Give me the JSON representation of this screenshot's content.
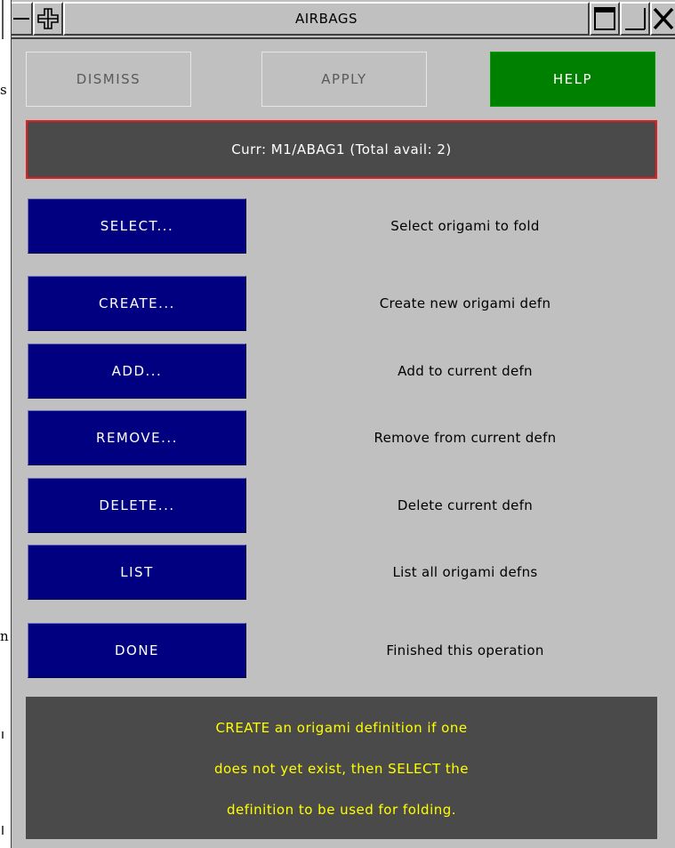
{
  "window": {
    "title": "AIRBAGS",
    "controls": {
      "menu_icon": "minus-icon",
      "move_icon": "move-cross-icon",
      "maximize_icon": "maximize-icon",
      "minimize_icon": "minimize-icon",
      "close_icon": "close-icon"
    }
  },
  "toolbar": {
    "dismiss_label": "DISMISS",
    "apply_label": "APPLY",
    "help_label": "HELP"
  },
  "current": {
    "text": "Curr: M1/ABAG1 (Total avail: 2)"
  },
  "actions": [
    {
      "label": "SELECT...",
      "description": "Select origami to fold"
    },
    {
      "label": "CREATE...",
      "description": "Create new origami defn"
    },
    {
      "label": "ADD...",
      "description": "Add to current defn"
    },
    {
      "label": "REMOVE...",
      "description": "Remove from current defn"
    },
    {
      "label": "DELETE...",
      "description": "Delete current defn"
    },
    {
      "label": "LIST",
      "description": "List all origami defns"
    },
    {
      "label": "DONE",
      "description": "Finished this operation"
    }
  ],
  "hint": {
    "lines": [
      "CREATE an origami definition if one",
      "does not yet exist, then SELECT the",
      "definition to be used for folding."
    ]
  },
  "colors": {
    "panel": "#c0c0c0",
    "action_button": "#000080",
    "help_button": "#008000",
    "current_border": "#e02020",
    "hint_text": "#ffff00",
    "dark_panel": "#4a4a4a"
  }
}
